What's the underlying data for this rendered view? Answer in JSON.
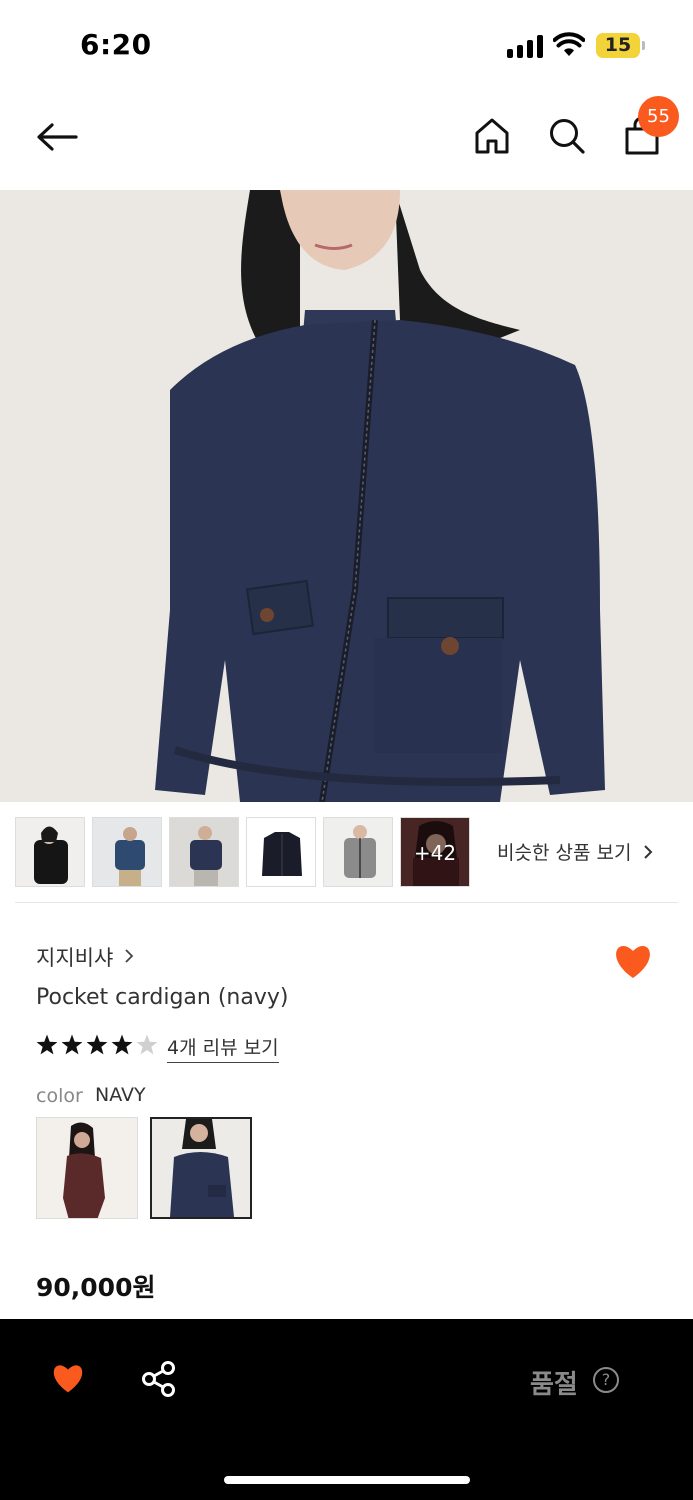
{
  "status_bar": {
    "time": "6:20",
    "battery": "15"
  },
  "nav": {
    "cart_count": "55"
  },
  "thumbnails": {
    "more_count": "+42",
    "similar_label": "비슷한 상품 보기"
  },
  "product": {
    "brand": "지지비샤",
    "name": "Pocket cardigan (navy)",
    "rating": 4,
    "rating_max": 5,
    "review_link": "4개 리뷰 보기",
    "color_label": "color",
    "color_value": "NAVY",
    "price": "90,000원"
  },
  "bottom_bar": {
    "soldout_label": "품절",
    "help_glyph": "?"
  },
  "colors": {
    "accent": "#fa5a1e",
    "navy": "#2b3452",
    "burgundy": "#5a2a2a"
  },
  "icons": [
    "back-arrow-icon",
    "home-icon",
    "search-icon",
    "shopping-bag-icon",
    "heart-icon",
    "share-icon",
    "star-icon",
    "chevron-right-icon",
    "help-icon"
  ]
}
